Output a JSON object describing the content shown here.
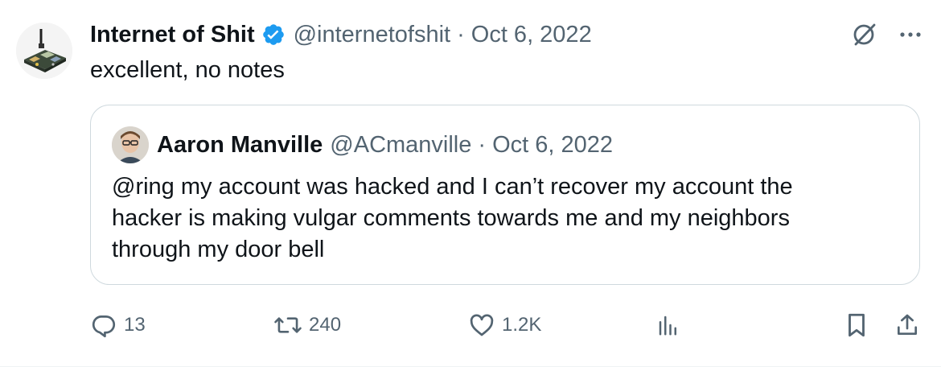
{
  "tweet": {
    "author": {
      "name": "Internet of Shit",
      "handle": "@internetofshit",
      "separator": "·",
      "date": "Oct 6, 2022",
      "verified": true
    },
    "text": "excellent, no notes",
    "quoted": {
      "author": {
        "name": "Aaron Manville",
        "handle": "@ACmanville",
        "separator": "·",
        "date": "Oct 6, 2022"
      },
      "text_lines": [
        "@ring my account was hacked and I can’t recover my account the",
        "hacker is making vulgar comments towards me and my neighbors",
        "through my door bell"
      ]
    },
    "stats": {
      "replies": "13",
      "reposts": "240",
      "likes": "1.2K"
    }
  },
  "icons": {
    "verified": "verified-badge-icon",
    "grok": "grok-icon",
    "more": "more-icon",
    "reply": "reply-icon",
    "repost": "repost-icon",
    "like": "like-icon",
    "views": "views-icon",
    "bookmark": "bookmark-icon",
    "share": "share-icon"
  },
  "colors": {
    "text_primary": "#0f1419",
    "text_secondary": "#536471",
    "verified_blue": "#1d9bf0",
    "border": "#cfd9de"
  }
}
